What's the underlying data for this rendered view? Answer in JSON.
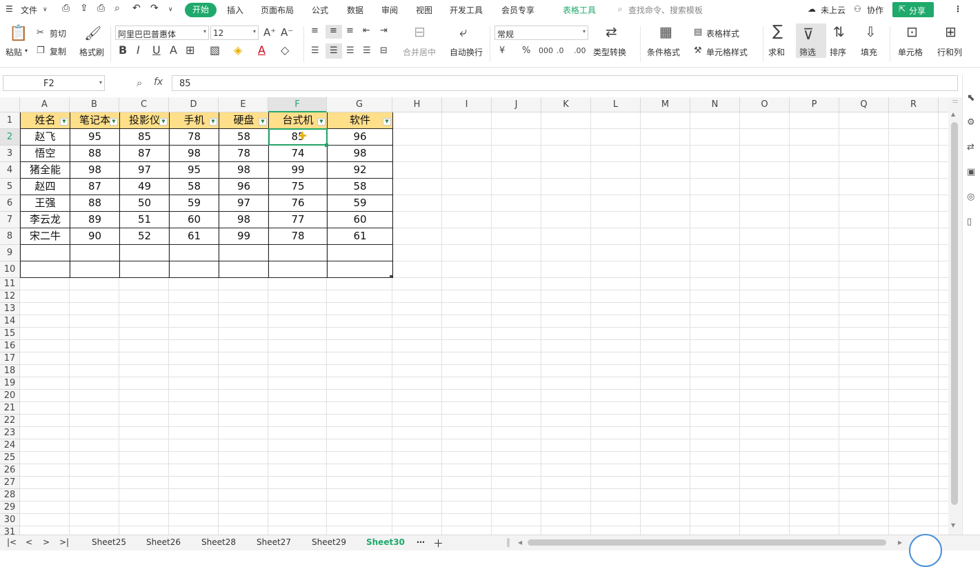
{
  "menu": {
    "file": "文件",
    "tabs": [
      "开始",
      "插入",
      "页面布局",
      "公式",
      "数据",
      "审阅",
      "视图",
      "开发工具",
      "会员专享"
    ],
    "table_tools": "表格工具",
    "search_placeholder": "查找命令、搜索模板",
    "cloud": "未上云",
    "collab": "协作",
    "share": "分享"
  },
  "ribbon": {
    "paste": "粘贴",
    "cut": "剪切",
    "copy": "复制",
    "format_painter": "格式刷",
    "font_name": "阿里巴巴普惠体",
    "font_size": "12",
    "merge_center": "合并居中",
    "wrap_text": "自动换行",
    "number_format": "常规",
    "type_convert": "类型转换",
    "cond_format": "条件格式",
    "table_style": "表格样式",
    "cell_style": "单元格样式",
    "sum": "求和",
    "filter": "筛选",
    "sort": "排序",
    "fill": "填充",
    "cell": "单元格",
    "row_col": "行和列"
  },
  "formula_bar": {
    "name_box": "F2",
    "fx": "fx",
    "value": "85"
  },
  "columns": [
    "A",
    "B",
    "C",
    "D",
    "E",
    "F",
    "G",
    "H",
    "I",
    "J",
    "K",
    "L",
    "M",
    "N",
    "O",
    "P",
    "Q",
    "R"
  ],
  "rows": [
    "1",
    "2",
    "3",
    "4",
    "5",
    "6",
    "7",
    "8",
    "9",
    "10",
    "11",
    "12",
    "13",
    "14",
    "15",
    "16",
    "17",
    "18",
    "19",
    "20",
    "21",
    "22",
    "23",
    "24",
    "25",
    "26",
    "27",
    "28",
    "29",
    "30",
    "31"
  ],
  "table": {
    "headers": [
      "姓名",
      "笔记本",
      "投影仪",
      "手机",
      "硬盘",
      "台式机",
      "软件"
    ],
    "data": [
      [
        "赵飞",
        "95",
        "85",
        "78",
        "58",
        "85",
        "96"
      ],
      [
        "悟空",
        "88",
        "87",
        "98",
        "78",
        "74",
        "98"
      ],
      [
        "猪全能",
        "98",
        "97",
        "95",
        "98",
        "99",
        "92"
      ],
      [
        "赵四",
        "87",
        "49",
        "58",
        "96",
        "75",
        "58"
      ],
      [
        "王强",
        "88",
        "50",
        "59",
        "97",
        "76",
        "59"
      ],
      [
        "李云龙",
        "89",
        "51",
        "60",
        "98",
        "77",
        "60"
      ],
      [
        "宋二牛",
        "90",
        "52",
        "61",
        "99",
        "78",
        "61"
      ]
    ]
  },
  "sheets": [
    "Sheet25",
    "Sheet26",
    "Sheet28",
    "Sheet27",
    "Sheet29",
    "Sheet30"
  ],
  "active_sheet": "Sheet30",
  "colors": {
    "accent": "#1fa96b",
    "header_fill": "#ffdf8a",
    "selection": "#21a366"
  }
}
